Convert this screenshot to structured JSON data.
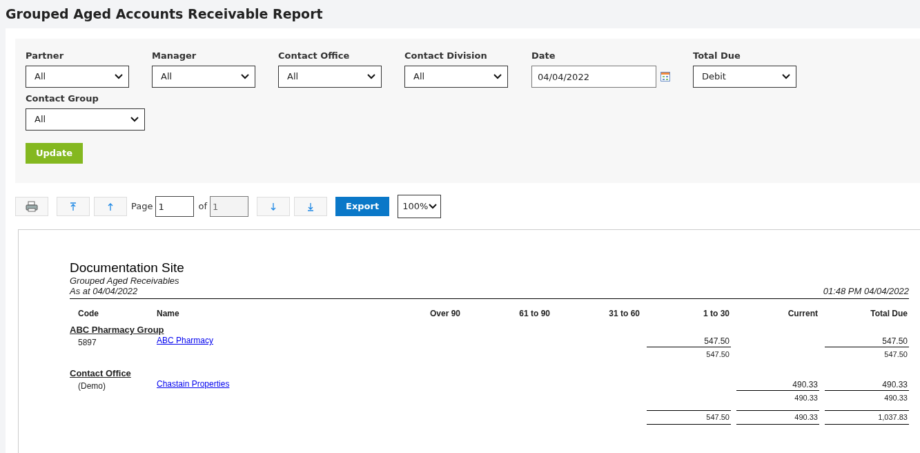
{
  "title": "Grouped Aged Accounts Receivable Report",
  "filters": [
    {
      "kind": "select",
      "label": "Partner",
      "value": "All"
    },
    {
      "kind": "select",
      "label": "Manager",
      "value": "All"
    },
    {
      "kind": "select",
      "label": "Contact Office",
      "value": "All"
    },
    {
      "kind": "select",
      "label": "Contact Division",
      "value": "All"
    },
    {
      "kind": "date",
      "label": "Date",
      "value": "04/04/2022"
    },
    {
      "kind": "select",
      "label": "Total Due",
      "value": "Debit"
    },
    {
      "kind": "select",
      "label": "Contact Group",
      "value": "All"
    }
  ],
  "update_button": "Update",
  "toolbar": {
    "page_label": "Page",
    "page": "1",
    "of_label": "of",
    "page_count": "1",
    "export_button": "Export",
    "zoom": "100%"
  },
  "report": {
    "company": "Documentation Site",
    "subtitle": "Grouped Aged Receivables",
    "as_at": "As at 04/04/2022",
    "printed": "01:48 PM 04/04/2022",
    "columns": [
      "Code",
      "Name",
      "Over 90",
      "61 to 90",
      "31 to 60",
      "1 to 30",
      "Current",
      "Total Due"
    ],
    "groups": [
      {
        "name": "ABC Pharmacy Group",
        "rows": [
          {
            "code": "5897",
            "name": "ABC Pharmacy",
            "amounts": {
              "1_to_30": "547.50",
              "total_due": "547.50"
            }
          }
        ],
        "subtotal": {
          "1_to_30": "547.50",
          "total_due": "547.50"
        }
      },
      {
        "name": "Contact Office",
        "rows": [
          {
            "code": "(Demo)",
            "name": "Chastain Properties",
            "amounts": {
              "current": "490.33",
              "total_due": "490.33"
            }
          }
        ],
        "subtotal": {
          "current": "490.33",
          "total_due": "490.33"
        }
      }
    ],
    "grand_total": {
      "1_to_30": "547.50",
      "current": "490.33",
      "total_due": "1,037.83"
    }
  }
}
